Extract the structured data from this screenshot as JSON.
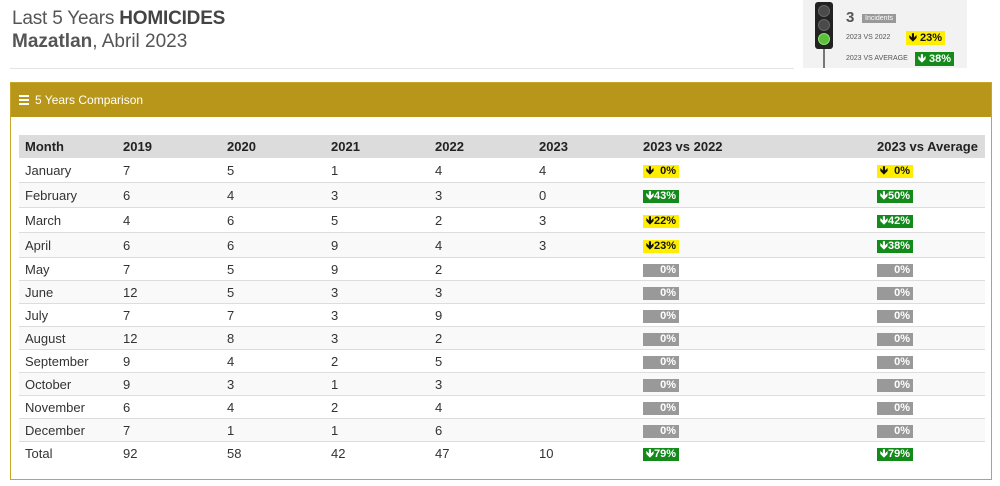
{
  "header": {
    "title_prefix": "Last 5 Years ",
    "title_bold": "HOMICIDES",
    "city": "Mazatlan",
    "period": ", Abril 2023"
  },
  "summary": {
    "count": "3",
    "incidents_label": "Incidents",
    "vs_2022_label": "2023 VS 2022",
    "vs_2022_value": "23%",
    "vs_2022_arrow": "down",
    "vs_average_label": "2023 VS AVERAGE",
    "vs_average_value": "38%",
    "vs_average_arrow": "down",
    "traffic_light_active": "green"
  },
  "panel": {
    "title": "5 Years Comparison"
  },
  "table": {
    "columns": [
      "Month",
      "2019",
      "2020",
      "2021",
      "2022",
      "2023",
      "2023 vs 2022",
      "2023 vs Average"
    ],
    "rows": [
      {
        "month": "January",
        "y2019": "7",
        "y2020": "5",
        "y2021": "1",
        "y2022": "4",
        "y2023": "4",
        "vs2022": {
          "text": "0%",
          "color": "yellow",
          "arrow": "down"
        },
        "vsavg": {
          "text": "0%",
          "color": "yellow",
          "arrow": "down"
        }
      },
      {
        "month": "February",
        "y2019": "6",
        "y2020": "4",
        "y2021": "3",
        "y2022": "3",
        "y2023": "0",
        "vs2022": {
          "text": "43%",
          "color": "green",
          "arrow": "down"
        },
        "vsavg": {
          "text": "50%",
          "color": "green",
          "arrow": "down"
        }
      },
      {
        "month": "March",
        "y2019": "4",
        "y2020": "6",
        "y2021": "5",
        "y2022": "2",
        "y2023": "3",
        "vs2022": {
          "text": "22%",
          "color": "yellow",
          "arrow": "down"
        },
        "vsavg": {
          "text": "42%",
          "color": "green",
          "arrow": "down"
        }
      },
      {
        "month": "April",
        "y2019": "6",
        "y2020": "6",
        "y2021": "9",
        "y2022": "4",
        "y2023": "3",
        "vs2022": {
          "text": "23%",
          "color": "yellow",
          "arrow": "down"
        },
        "vsavg": {
          "text": "38%",
          "color": "green",
          "arrow": "down"
        }
      },
      {
        "month": "May",
        "y2019": "7",
        "y2020": "5",
        "y2021": "9",
        "y2022": "2",
        "y2023": "",
        "vs2022": {
          "text": "0%",
          "color": "grey",
          "arrow": ""
        },
        "vsavg": {
          "text": "0%",
          "color": "grey",
          "arrow": ""
        }
      },
      {
        "month": "June",
        "y2019": "12",
        "y2020": "5",
        "y2021": "3",
        "y2022": "3",
        "y2023": "",
        "vs2022": {
          "text": "0%",
          "color": "grey",
          "arrow": ""
        },
        "vsavg": {
          "text": "0%",
          "color": "grey",
          "arrow": ""
        }
      },
      {
        "month": "July",
        "y2019": "7",
        "y2020": "7",
        "y2021": "3",
        "y2022": "9",
        "y2023": "",
        "vs2022": {
          "text": "0%",
          "color": "grey",
          "arrow": ""
        },
        "vsavg": {
          "text": "0%",
          "color": "grey",
          "arrow": ""
        }
      },
      {
        "month": "August",
        "y2019": "12",
        "y2020": "8",
        "y2021": "3",
        "y2022": "2",
        "y2023": "",
        "vs2022": {
          "text": "0%",
          "color": "grey",
          "arrow": ""
        },
        "vsavg": {
          "text": "0%",
          "color": "grey",
          "arrow": ""
        }
      },
      {
        "month": "September",
        "y2019": "9",
        "y2020": "4",
        "y2021": "2",
        "y2022": "5",
        "y2023": "",
        "vs2022": {
          "text": "0%",
          "color": "grey",
          "arrow": ""
        },
        "vsavg": {
          "text": "0%",
          "color": "grey",
          "arrow": ""
        }
      },
      {
        "month": "October",
        "y2019": "9",
        "y2020": "3",
        "y2021": "1",
        "y2022": "3",
        "y2023": "",
        "vs2022": {
          "text": "0%",
          "color": "grey",
          "arrow": ""
        },
        "vsavg": {
          "text": "0%",
          "color": "grey",
          "arrow": ""
        }
      },
      {
        "month": "November",
        "y2019": "6",
        "y2020": "4",
        "y2021": "2",
        "y2022": "4",
        "y2023": "",
        "vs2022": {
          "text": "0%",
          "color": "grey",
          "arrow": ""
        },
        "vsavg": {
          "text": "0%",
          "color": "grey",
          "arrow": ""
        }
      },
      {
        "month": "December",
        "y2019": "7",
        "y2020": "1",
        "y2021": "1",
        "y2022": "6",
        "y2023": "",
        "vs2022": {
          "text": "0%",
          "color": "grey",
          "arrow": ""
        },
        "vsavg": {
          "text": "0%",
          "color": "grey",
          "arrow": ""
        }
      },
      {
        "month": "Total",
        "y2019": "92",
        "y2020": "58",
        "y2021": "42",
        "y2022": "47",
        "y2023": "10",
        "vs2022": {
          "text": "79%",
          "color": "green",
          "arrow": "down"
        },
        "vsavg": {
          "text": "79%",
          "color": "green",
          "arrow": "down"
        }
      }
    ]
  },
  "colors": {
    "panel_header": "#b8961a",
    "badge_yellow": "#ffee00",
    "badge_green": "#138a1a",
    "badge_grey": "#999999"
  }
}
